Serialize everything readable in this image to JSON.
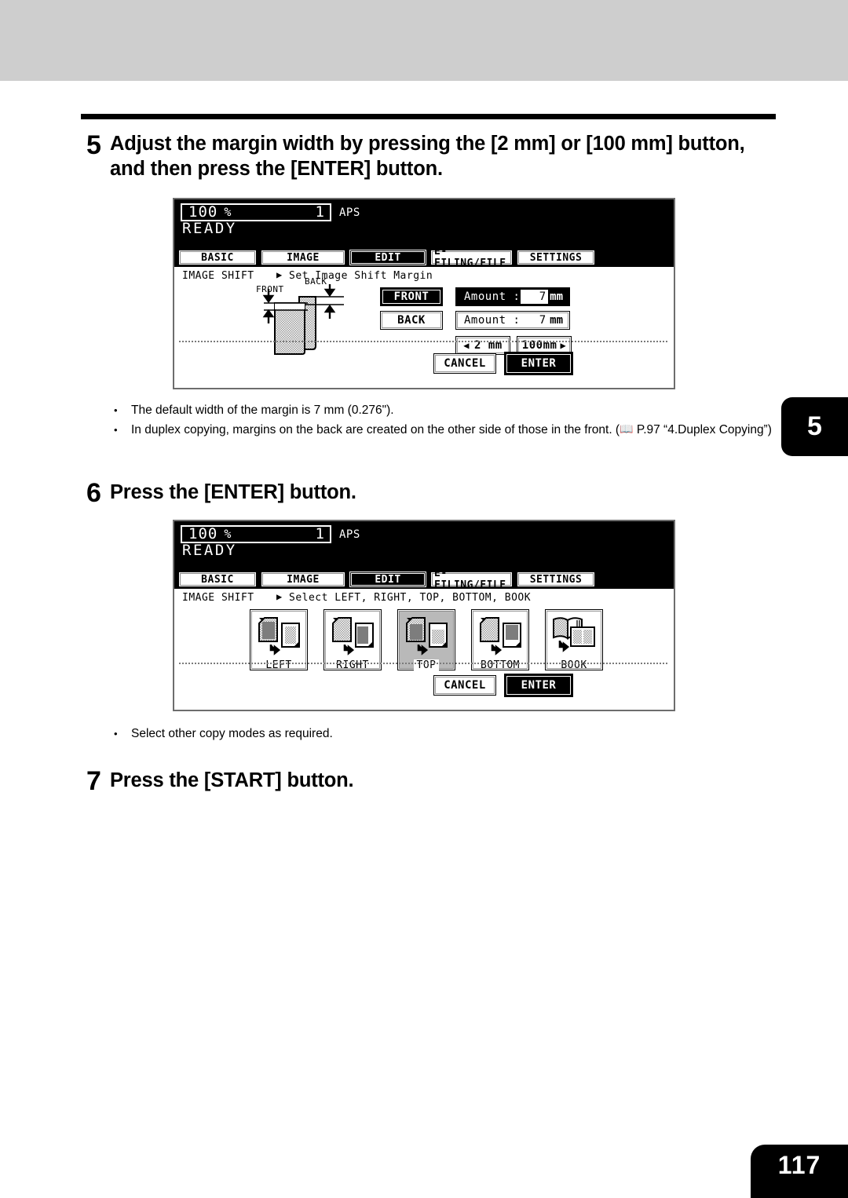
{
  "page": {
    "number": "117",
    "side_tab": "5"
  },
  "steps": [
    {
      "num": "5",
      "line1": "Adjust the margin width by pressing the [2 mm] or [100 mm] button,",
      "line2": "and then press the [ENTER] button."
    },
    {
      "num": "6",
      "line1": "Press the [ENTER] button."
    },
    {
      "num": "7",
      "line1": "Press the [START] button."
    }
  ],
  "notes1": [
    {
      "bullet": "•",
      "text": "The default width of the margin is 7 mm (0.276\")."
    },
    {
      "bullet": "•",
      "text_before": "In duplex copying, margins on the back are created on the other side of those in the front. (",
      "icon": "book-icon",
      "text_after": " P.97 “4.Duplex Copying”)"
    }
  ],
  "notes2": [
    {
      "bullet": "•",
      "text": "Select other copy modes as required."
    }
  ],
  "lcd1": {
    "status": {
      "ratio": "100",
      "percent": "%",
      "copies": "1",
      "paper_mode": "APS",
      "state": "READY"
    },
    "tabs": [
      {
        "label": "BASIC",
        "selected": false
      },
      {
        "label": "IMAGE",
        "selected": false
      },
      {
        "label": "EDIT",
        "selected": true
      },
      {
        "label": "E-FILING/FILE",
        "selected": false
      },
      {
        "label": "SETTINGS",
        "selected": false
      }
    ],
    "breadcrumb": "IMAGE SHIFT",
    "breadcrumb_arrow": "▶",
    "breadcrumb_sub": "Set Image Shift Margin",
    "diagram": {
      "label_front": "FRONT",
      "label_back": "BACK"
    },
    "side_buttons": [
      {
        "label": "FRONT",
        "selected": true
      },
      {
        "label": "BACK",
        "selected": false
      }
    ],
    "amounts": [
      {
        "label": "Amount :",
        "value": "7",
        "unit": "mm",
        "selected": true
      },
      {
        "label": "Amount :",
        "value": "7",
        "unit": "mm",
        "selected": false
      }
    ],
    "steppers": [
      {
        "arrow": "◀",
        "label": "2 mm",
        "dir": "left"
      },
      {
        "arrow": "▶",
        "label": "100mm",
        "dir": "right"
      }
    ],
    "footer": [
      {
        "label": "CANCEL",
        "selected": false
      },
      {
        "label": "ENTER",
        "selected": true
      }
    ]
  },
  "lcd2": {
    "status": {
      "ratio": "100",
      "percent": "%",
      "copies": "1",
      "paper_mode": "APS",
      "state": "READY"
    },
    "tabs": [
      {
        "label": "BASIC",
        "selected": false
      },
      {
        "label": "IMAGE",
        "selected": false
      },
      {
        "label": "EDIT",
        "selected": true
      },
      {
        "label": "E-FILING/FILE",
        "selected": false
      },
      {
        "label": "SETTINGS",
        "selected": false
      }
    ],
    "breadcrumb": "IMAGE SHIFT",
    "breadcrumb_arrow": "▶",
    "breadcrumb_sub": "Select LEFT, RIGHT, TOP, BOTTOM, BOOK",
    "modes": [
      {
        "label": "LEFT",
        "selected": false,
        "icon": "shift-left-icon"
      },
      {
        "label": "RIGHT",
        "selected": false,
        "icon": "shift-right-icon"
      },
      {
        "label": "TOP",
        "selected": true,
        "icon": "shift-top-icon"
      },
      {
        "label": "BOTTOM",
        "selected": false,
        "icon": "shift-bottom-icon"
      },
      {
        "label": "BOOK",
        "selected": false,
        "icon": "shift-book-icon"
      }
    ],
    "footer": [
      {
        "label": "CANCEL",
        "selected": false
      },
      {
        "label": "ENTER",
        "selected": true
      }
    ]
  },
  "colors": {
    "band": "#cecece",
    "lcd_border": "#6d6d6d",
    "ink": "#000000",
    "selected_fill": "#b9b9b9"
  }
}
